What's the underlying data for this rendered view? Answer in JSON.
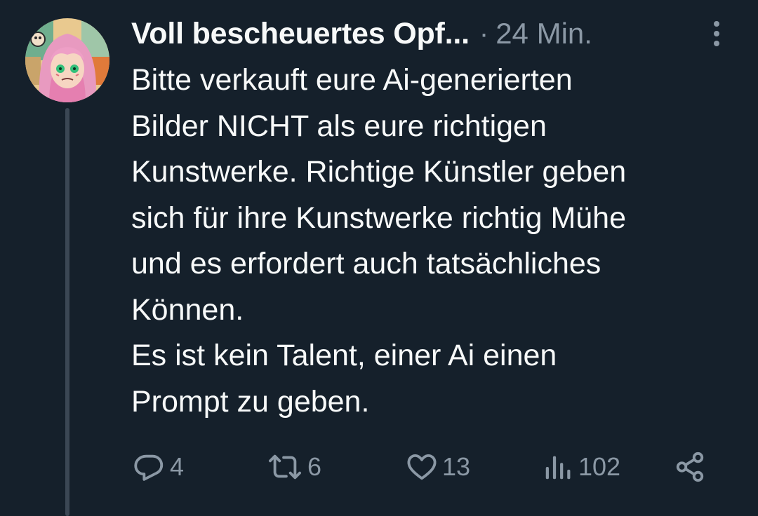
{
  "tweet": {
    "author": {
      "display_name": "Voll bescheuertes Opf...",
      "avatar_icon": "anime-girl-avatar"
    },
    "separator": "·",
    "time": "24 Min.",
    "text_lines": [
      "Bitte verkauft eure Ai-generierten",
      "Bilder NICHT als eure richtigen",
      "Kunstwerke. Richtige Künstler geben",
      "sich für ihre Kunstwerke richtig Mühe",
      "und es erfordert auch tatsächliches",
      "Können.",
      "Es ist kein Talent, einer Ai einen",
      "Prompt zu geben."
    ],
    "actions": {
      "replies": "4",
      "retweets": "6",
      "likes": "13",
      "views": "102"
    }
  },
  "colors": {
    "background": "#15202b",
    "text": "#f7f9f9",
    "secondary": "#8b98a5",
    "thread_line": "#3b4754"
  }
}
